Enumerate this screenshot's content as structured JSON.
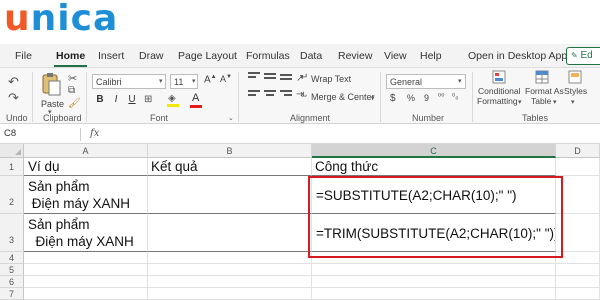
{
  "logo": {
    "text_u": "u",
    "text_rest": "nica"
  },
  "menu": {
    "items": [
      "File",
      "Home",
      "Insert",
      "Draw",
      "Page Layout",
      "Formulas",
      "Data",
      "Review",
      "View",
      "Help",
      "Open in Desktop App"
    ],
    "active": "Home",
    "edit_label": "Ed"
  },
  "ribbon": {
    "undo_label": "Undo",
    "clipboard_label": "Clipboard",
    "paste_label": "Paste",
    "font_name": "Calibri",
    "font_size": "11",
    "font_label": "Font",
    "bold": "B",
    "italic": "I",
    "underline": "U",
    "wrap_text": "Wrap Text",
    "merge_center": "Merge & Center",
    "alignment_label": "Alignment",
    "number_format": "General",
    "currency_symbol": "$",
    "number_label": "Number",
    "conditional_formatting_line1": "Conditional",
    "conditional_formatting_line2": "Formatting",
    "format_as_table_line1": "Format As",
    "format_as_table_line2": "Table",
    "styles_label": "Styles",
    "tables_label": "Tables",
    "dropdown_glyph": "▾",
    "dialog_launcher_glyph": "⌄"
  },
  "formula_bar": {
    "name_box": "C8",
    "fx": "fx",
    "content": ""
  },
  "grid": {
    "columns": [
      "A",
      "B",
      "C",
      "D"
    ],
    "selected_column": "C",
    "rows": [
      "1",
      "2",
      "3",
      "4",
      "5",
      "6",
      "7"
    ],
    "cells": {
      "A1": "Ví dụ",
      "B1": "Kết quả",
      "C1": "Công thức",
      "A2": "Sản phẩm\n Điện máy XANH",
      "C2": "=SUBSTITUTE(A2;CHAR(10);\" \")",
      "A3": "Sản phẩm\n  Điện máy XANH",
      "C3": "=TRIM(SUBSTITUTE(A2;CHAR(10);\" \"))"
    }
  },
  "colors": {
    "excel_green": "#217346",
    "highlight_red": "#d71920",
    "logo_blue": "#1e8fd6",
    "logo_orange": "#f05a28"
  }
}
